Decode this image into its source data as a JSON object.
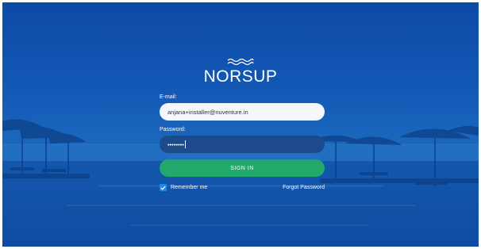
{
  "brand": {
    "name": "NORSUP"
  },
  "login": {
    "email_label": "E-mail:",
    "email_value": "anjana+installer@nuventure.in",
    "password_label": "Password:",
    "password_value": "••••••••",
    "signin_label": "SIGN IN",
    "remember_label": "Remember me",
    "remember_checked": true,
    "forgot_label": "Forgot Password"
  },
  "colors": {
    "background": "#1358b5",
    "button": "#22a86a",
    "checkbox": "#1e88e5",
    "input_light": "#f4f7fb",
    "input_dark": "#1d4a8a"
  }
}
